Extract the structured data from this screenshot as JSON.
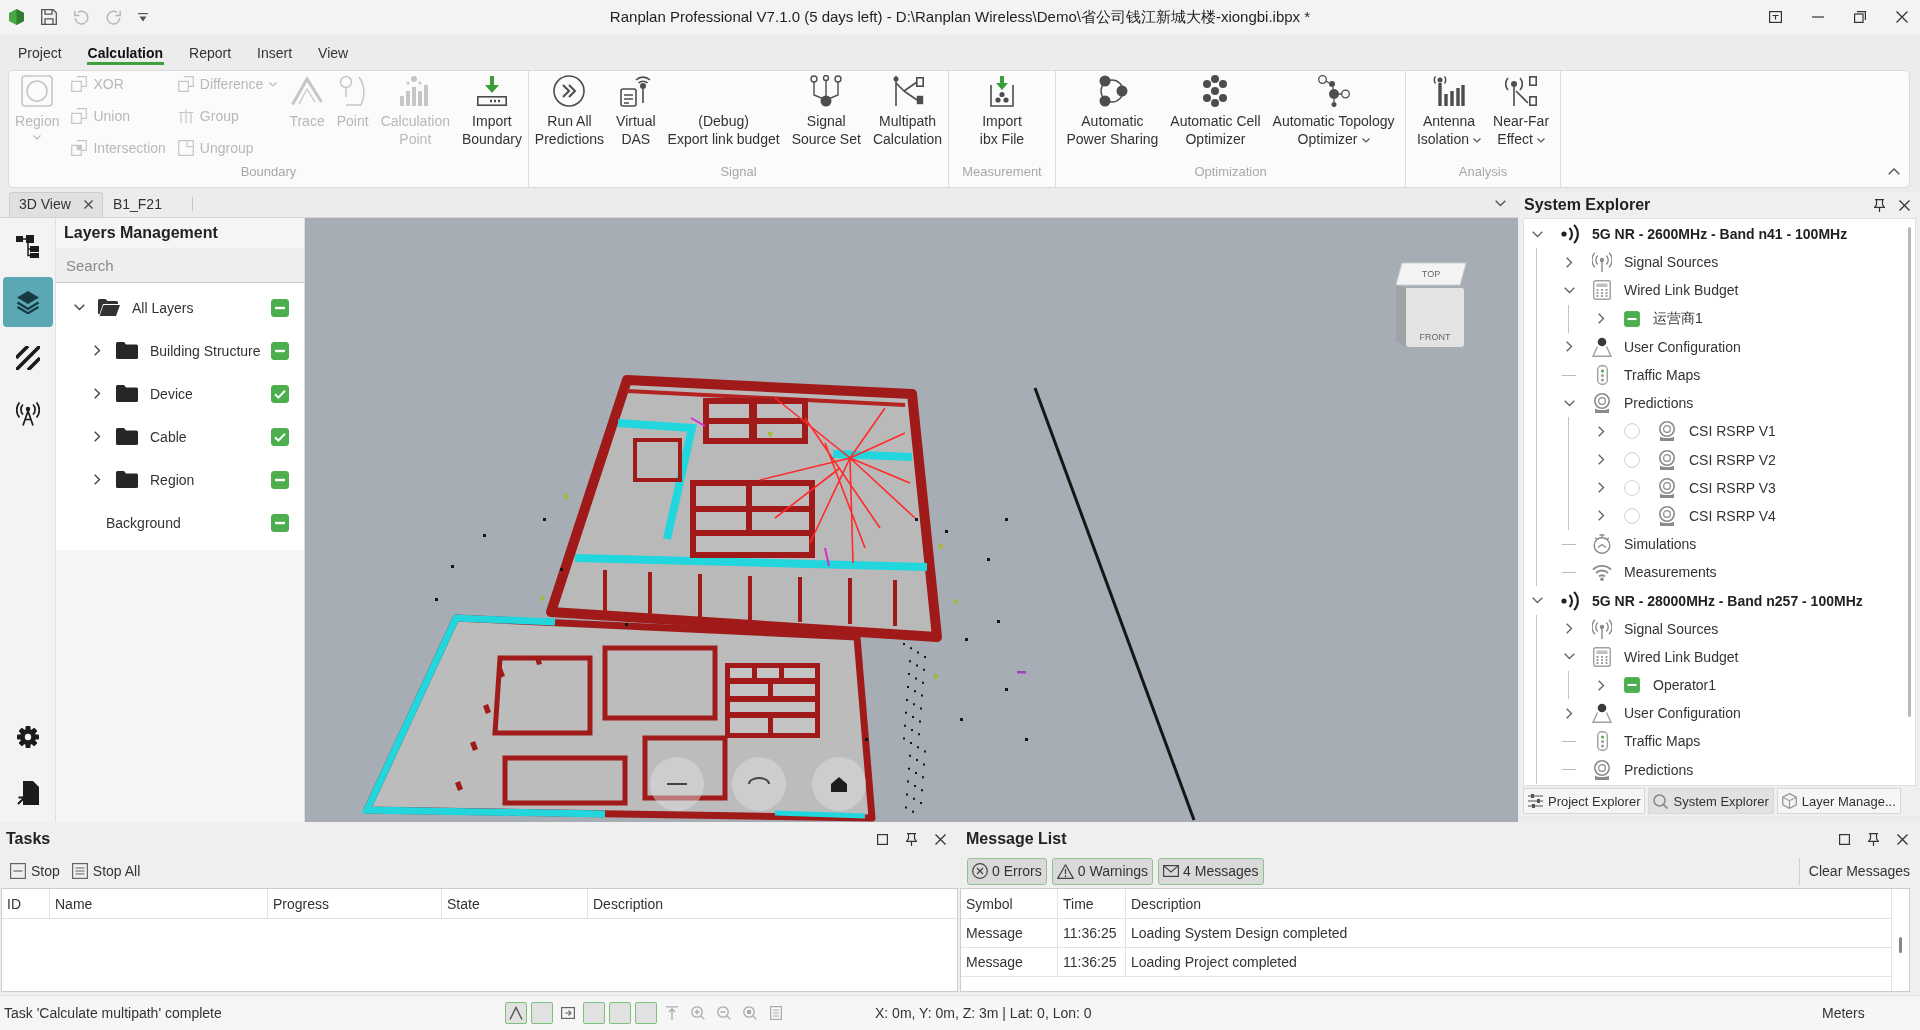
{
  "window": {
    "title": "Ranplan Professional V7.1.0 (5 days left) - D:\\Ranplan Wireless\\Demo\\省公司钱江新城大楼-xiongbi.ibpx *"
  },
  "menu_tabs": [
    {
      "label": "Project",
      "selected": false
    },
    {
      "label": "Calculation",
      "selected": true
    },
    {
      "label": "Report",
      "selected": false
    },
    {
      "label": "Insert",
      "selected": false
    },
    {
      "label": "View",
      "selected": false
    }
  ],
  "ribbon": {
    "groups": [
      {
        "label": "Boundary",
        "items": [
          {
            "kind": "large",
            "lines": [
              "Region"
            ],
            "disabled": true,
            "dropdown": true
          },
          {
            "kind": "stack",
            "items": [
              {
                "label": "XOR",
                "disabled": true
              },
              {
                "label": "Union",
                "disabled": true
              },
              {
                "label": "Intersection",
                "disabled": true
              }
            ]
          },
          {
            "kind": "stack",
            "items": [
              {
                "label": "Difference",
                "disabled": true,
                "dropdown": true
              },
              {
                "label": "Group",
                "disabled": true
              },
              {
                "label": "Ungroup",
                "disabled": true
              }
            ]
          },
          {
            "kind": "large",
            "lines": [
              "Trace"
            ],
            "disabled": true
          },
          {
            "kind": "large",
            "lines": [
              "Point"
            ],
            "disabled": true
          },
          {
            "kind": "large",
            "lines": [
              "Calculation",
              "Point"
            ],
            "disabled": true
          },
          {
            "kind": "large",
            "lines": [
              "Import",
              "Boundary"
            ],
            "disabled": false
          }
        ]
      },
      {
        "label": "Signal",
        "items": [
          {
            "kind": "large",
            "lines": [
              "Run All",
              "Predictions"
            ],
            "disabled": false
          },
          {
            "kind": "large",
            "lines": [
              "Virtual",
              "DAS"
            ],
            "disabled": false
          },
          {
            "kind": "large",
            "lines": [
              "(Debug)",
              "Export link budget"
            ],
            "disabled": false
          },
          {
            "kind": "large",
            "lines": [
              "Signal",
              "Source Set"
            ],
            "disabled": false
          },
          {
            "kind": "large",
            "lines": [
              "Multipath",
              "Calculation"
            ],
            "disabled": false
          }
        ]
      },
      {
        "label": "Measurement",
        "items": [
          {
            "kind": "large",
            "lines": [
              "Import",
              "ibx File"
            ],
            "disabled": false
          }
        ]
      },
      {
        "label": "Optimization",
        "items": [
          {
            "kind": "large",
            "lines": [
              "Automatic",
              "Power Sharing"
            ],
            "disabled": false
          },
          {
            "kind": "large",
            "lines": [
              "Automatic Cell",
              "Optimizer"
            ],
            "disabled": false
          },
          {
            "kind": "large",
            "lines": [
              "Automatic Topology",
              "Optimizer"
            ],
            "disabled": false,
            "dropdown": true
          }
        ]
      },
      {
        "label": "Analysis",
        "items": [
          {
            "kind": "large",
            "lines": [
              "Antenna",
              "Isolation"
            ],
            "disabled": false,
            "dropdown": true
          },
          {
            "kind": "large",
            "lines": [
              "Near-Far",
              "Effect"
            ],
            "disabled": false,
            "dropdown": true
          }
        ]
      }
    ]
  },
  "doc_tabs": [
    {
      "label": "3D View",
      "selected": true,
      "closable": true
    },
    {
      "label": "B1_F21",
      "selected": false
    }
  ],
  "activity_bar": {
    "top": [
      {
        "selected": false
      },
      {
        "selected": true
      },
      {
        "selected": false
      },
      {
        "selected": false
      }
    ],
    "bottom": [
      {
        "selected": false
      },
      {
        "selected": false
      }
    ]
  },
  "layers_panel": {
    "title": "Layers Management",
    "search": {
      "placeholder": "Search"
    },
    "tree": [
      {
        "label": "All Layers",
        "kind": "folder",
        "expanded": true,
        "checked": true,
        "partial": true,
        "children": [
          {
            "label": "Building Structure",
            "kind": "folder",
            "expanded": false,
            "checked": true,
            "partial": true
          },
          {
            "label": "Device",
            "kind": "folder",
            "expanded": false,
            "checked": true,
            "partial": false
          },
          {
            "label": "Cable",
            "kind": "folder",
            "expanded": false,
            "checked": true,
            "partial": false
          },
          {
            "label": "Region",
            "kind": "folder",
            "expanded": false,
            "checked": true,
            "partial": true
          }
        ]
      },
      {
        "label": "Background",
        "kind": "layer",
        "checked": true,
        "partial": true
      }
    ]
  },
  "viewport": {
    "view_cube": {
      "top": "TOP",
      "front": "FRONT"
    }
  },
  "system_explorer": {
    "title": "System Explorer",
    "tree": [
      {
        "label": "5G NR - 2600MHz - Band n41 - 100MHz",
        "kind": "band",
        "expanded": true,
        "children": [
          {
            "label": "Signal Sources",
            "kind": "sources",
            "expanded": false
          },
          {
            "label": "Wired Link Budget",
            "kind": "budget",
            "expanded": true,
            "children": [
              {
                "label": "运营商1",
                "kind": "operator",
                "expanded": false,
                "checked": true,
                "partial": true
              }
            ]
          },
          {
            "label": "User Configuration",
            "kind": "users",
            "expanded": false
          },
          {
            "label": "Traffic Maps",
            "kind": "traffic"
          },
          {
            "label": "Predictions",
            "kind": "predictions",
            "expanded": true,
            "children": [
              {
                "label": "CSI RSRP V1",
                "kind": "prediction",
                "expanded": false,
                "selected": false
              },
              {
                "label": "CSI RSRP V2",
                "kind": "prediction",
                "expanded": false,
                "selected": false
              },
              {
                "label": "CSI RSRP V3",
                "kind": "prediction",
                "expanded": false,
                "selected": false
              },
              {
                "label": "CSI RSRP V4",
                "kind": "prediction",
                "expanded": false,
                "selected": false
              }
            ]
          },
          {
            "label": "Simulations",
            "kind": "simulations"
          },
          {
            "label": "Measurements",
            "kind": "measurements"
          }
        ]
      },
      {
        "label": "5G NR - 28000MHz - Band n257 - 100MHz",
        "kind": "band",
        "expanded": true,
        "children": [
          {
            "label": "Signal Sources",
            "kind": "sources",
            "expanded": false
          },
          {
            "label": "Wired Link Budget",
            "kind": "budget",
            "expanded": true,
            "children": [
              {
                "label": "Operator1",
                "kind": "operator",
                "expanded": false,
                "checked": true,
                "partial": true
              }
            ]
          },
          {
            "label": "User Configuration",
            "kind": "users",
            "expanded": false
          },
          {
            "label": "Traffic Maps",
            "kind": "traffic"
          },
          {
            "label": "Predictions",
            "kind": "predictions"
          }
        ]
      }
    ],
    "bottom_tabs": [
      {
        "label": "Project Explorer",
        "selected": false
      },
      {
        "label": "System Explorer",
        "selected": true
      },
      {
        "label": "Layer Manage...",
        "selected": false
      }
    ]
  },
  "tasks": {
    "title": "Tasks",
    "toolbar": [
      {
        "label": "Stop"
      },
      {
        "label": "Stop All"
      }
    ],
    "columns": [
      "ID",
      "Name",
      "Progress",
      "State",
      "Description"
    ]
  },
  "messages": {
    "title": "Message List",
    "filters": [
      {
        "label": "0 Errors",
        "selected": true
      },
      {
        "label": "0 Warnings",
        "selected": true
      },
      {
        "label": "4 Messages",
        "selected": true
      }
    ],
    "clear_label": "Clear Messages",
    "columns": [
      "Symbol",
      "Time",
      "Description"
    ],
    "rows": [
      {
        "symbol": "Message",
        "time": "11:36:25",
        "description": "Loading System Design completed"
      },
      {
        "symbol": "Message",
        "time": "11:36:25",
        "description": "Loading Project completed"
      }
    ]
  },
  "status_bar": {
    "message": "Task 'Calculate multipath' complete",
    "tools": [
      {
        "selected": true
      },
      {
        "selected": true
      },
      {
        "selected": false
      },
      {
        "selected": true
      },
      {
        "selected": true
      },
      {
        "selected": true
      },
      {
        "selected": false
      },
      {
        "selected": false
      },
      {
        "selected": false
      },
      {
        "selected": false
      },
      {
        "selected": false
      }
    ],
    "coordinates": "X: 0m, Y: 0m, Z: 3m | Lat: 0, Lon: 0",
    "units": "Meters"
  }
}
